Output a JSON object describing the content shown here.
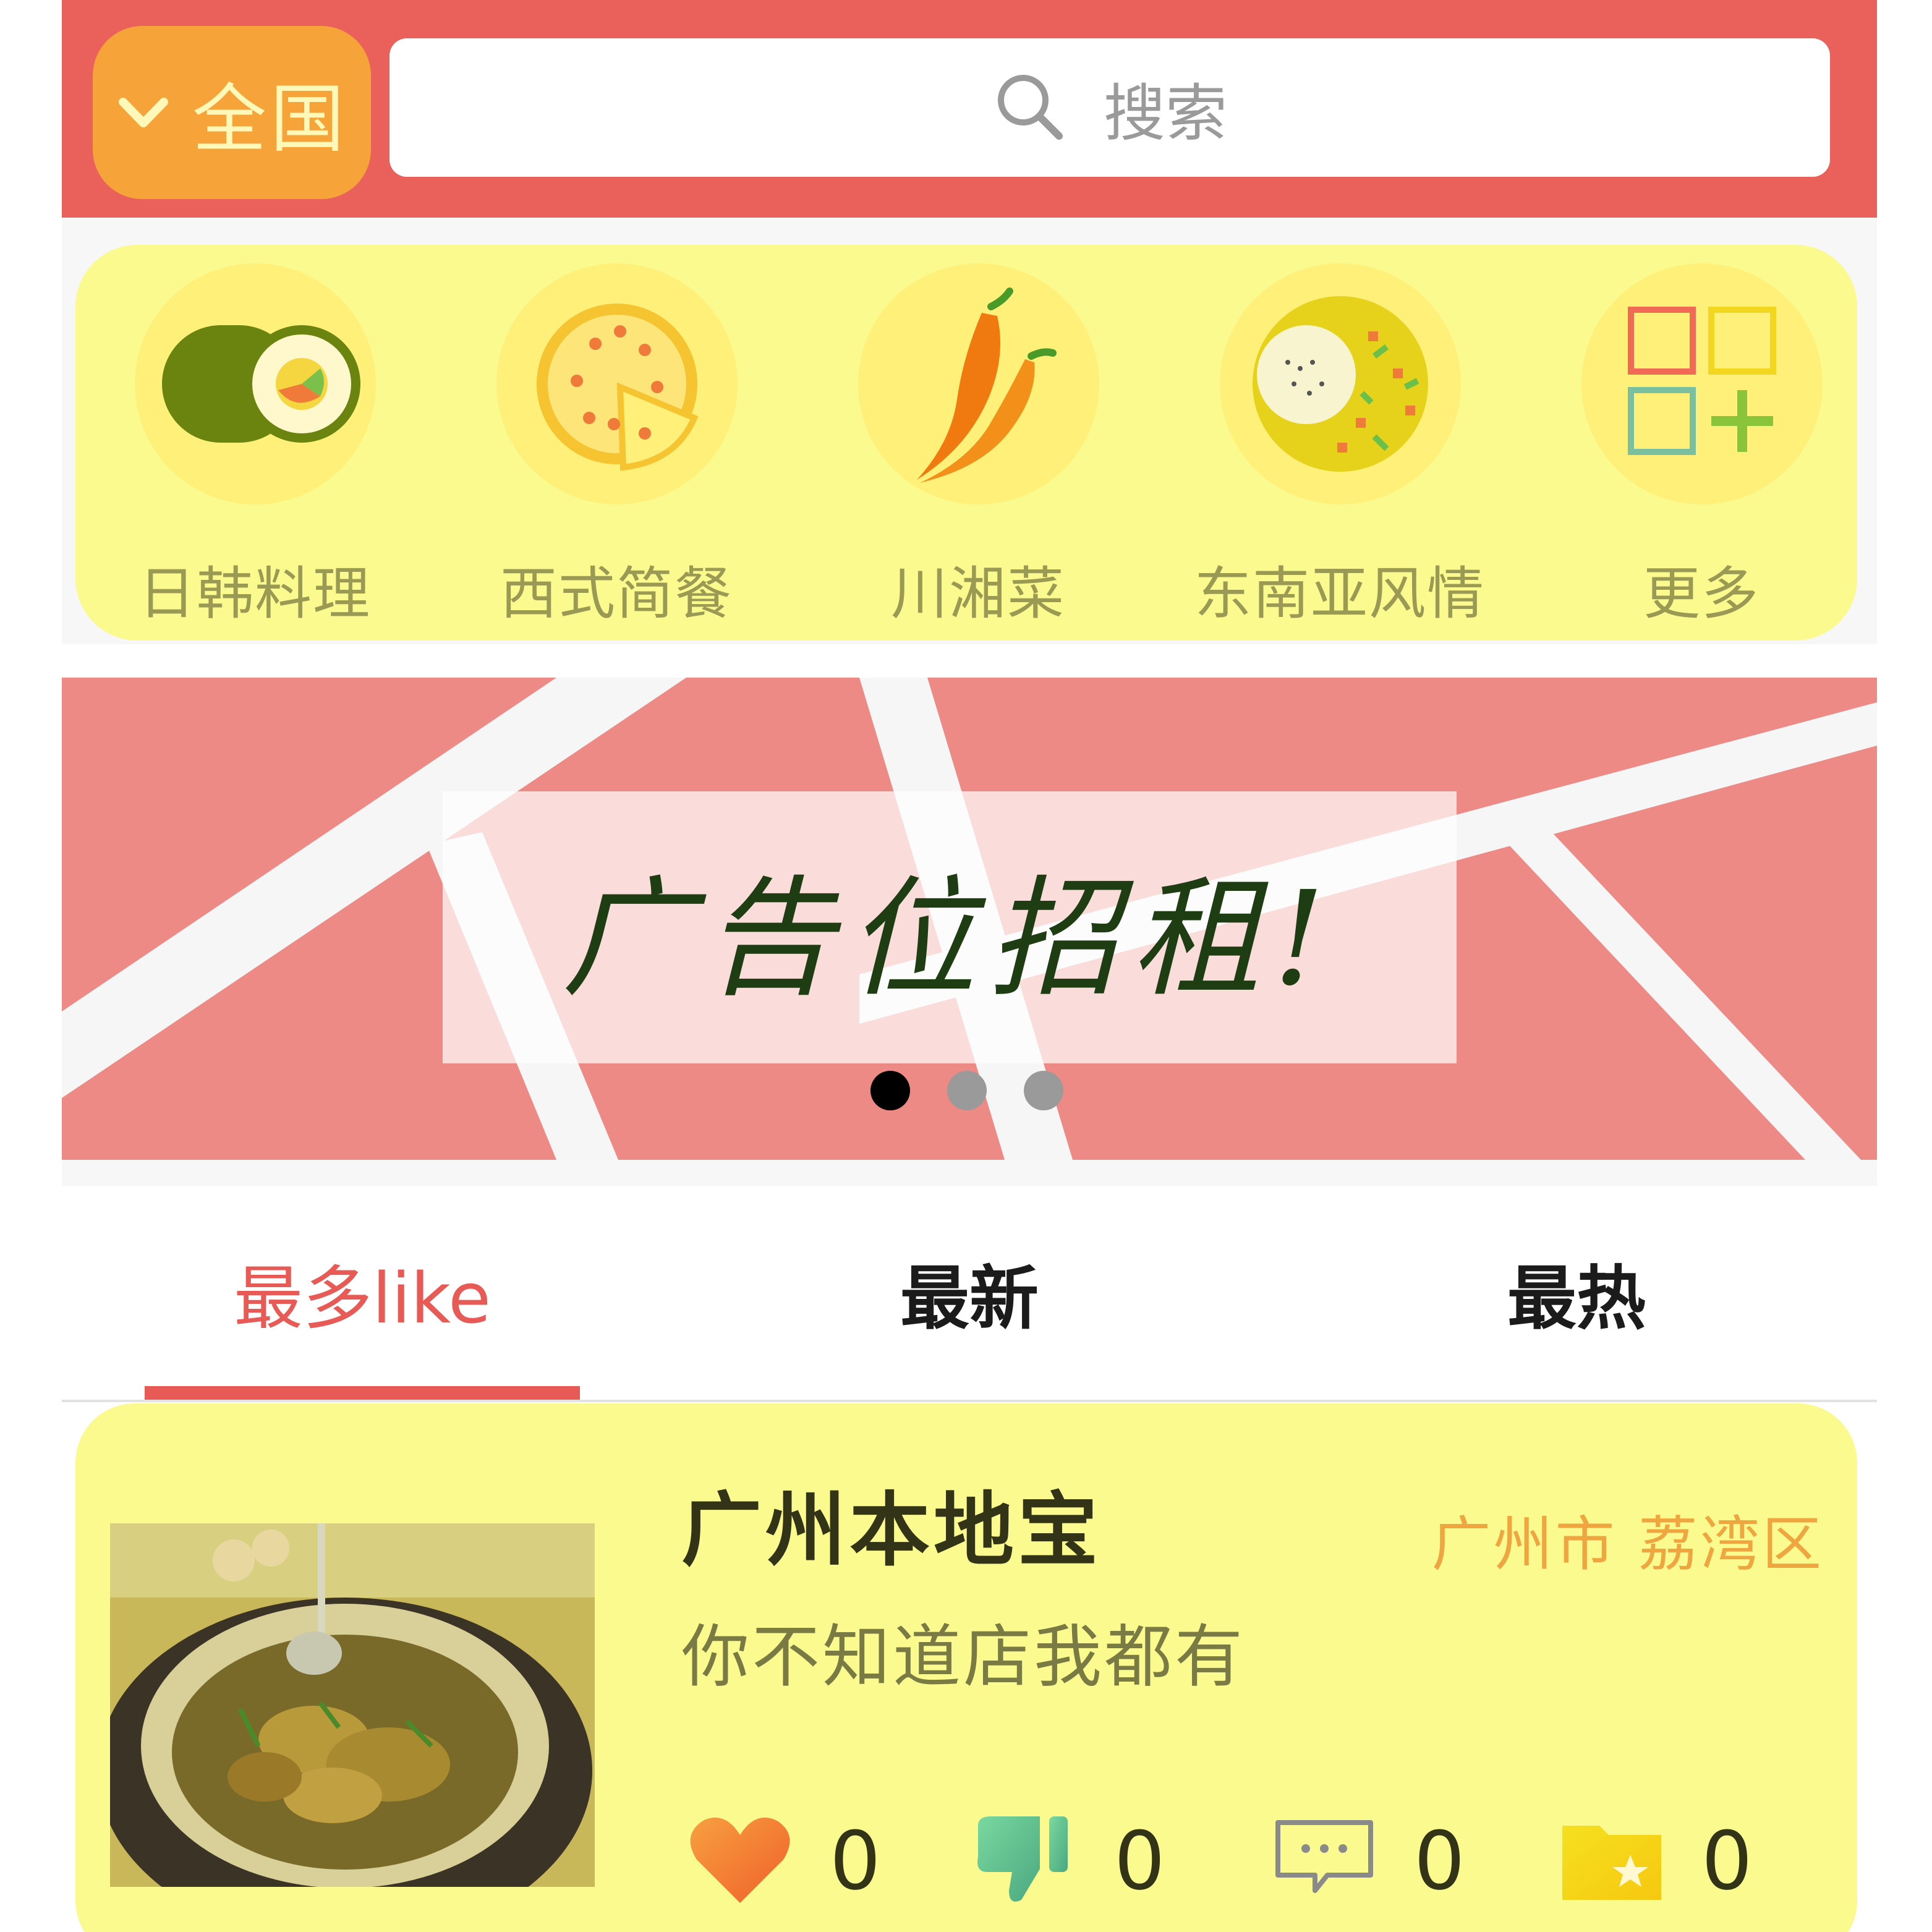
{
  "header": {
    "region_label": "全国",
    "search_placeholder": "搜索"
  },
  "categories": [
    {
      "label": "日韩料理",
      "icon": "sushi-roll-icon"
    },
    {
      "label": "西式简餐",
      "icon": "pizza-icon"
    },
    {
      "label": "川湘菜",
      "icon": "chili-pepper-icon"
    },
    {
      "label": "东南亚风情",
      "icon": "fried-rice-icon"
    },
    {
      "label": "更多",
      "icon": "more-grid-icon"
    }
  ],
  "banner": {
    "ad_text": "广告位招租!",
    "slide_count": 3,
    "active_slide": 1
  },
  "tabs": [
    {
      "label": "最多like",
      "active": true
    },
    {
      "label": "最新",
      "active": false
    },
    {
      "label": "最热",
      "active": false
    }
  ],
  "list": {
    "items": [
      {
        "title": "广州本地宝",
        "location": "广州市 荔湾区",
        "description": "你不知道店我都有",
        "likes": "0",
        "dislikes": "0",
        "comments": "0",
        "favorites": "0"
      }
    ]
  },
  "colors": {
    "header_red": "#ea605b",
    "region_orange": "#f6a43a",
    "panel_yellow": "#fafa8f",
    "tab_active": "#e85a55",
    "banner_pink": "#ee8a85"
  }
}
